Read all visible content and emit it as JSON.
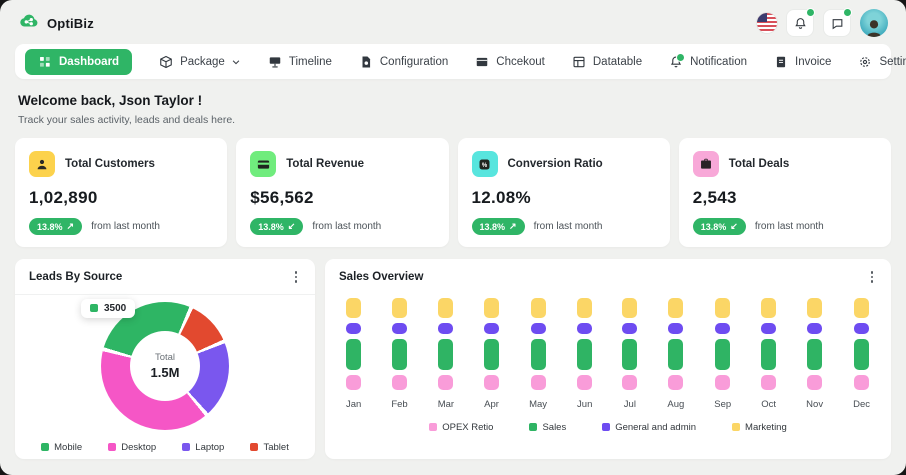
{
  "brand": {
    "name": "OptiBiz"
  },
  "header": {
    "icons": [
      {
        "name": "us-flag-icon"
      },
      {
        "name": "bell-icon",
        "badge": true
      },
      {
        "name": "chat-icon",
        "badge": true
      },
      {
        "name": "user-avatar"
      }
    ]
  },
  "nav": {
    "items": [
      {
        "id": "dashboard",
        "label": "Dashboard",
        "icon": "grid-icon",
        "active": true
      },
      {
        "id": "package",
        "label": "Package",
        "icon": "package-icon",
        "chevron": true
      },
      {
        "id": "timeline",
        "label": "Timeline",
        "icon": "timeline-icon"
      },
      {
        "id": "configuration",
        "label": "Configuration",
        "icon": "configuration-icon"
      },
      {
        "id": "chcekout",
        "label": "Chcekout",
        "icon": "checkout-icon"
      },
      {
        "id": "datatable",
        "label": "Datatable",
        "icon": "datatable-icon"
      },
      {
        "id": "notification",
        "label": "Notification",
        "icon": "notification-icon",
        "dot": true
      },
      {
        "id": "invoice",
        "label": "Invoice",
        "icon": "invoice-icon"
      },
      {
        "id": "settings",
        "label": "Settings",
        "icon": "settings-icon"
      }
    ]
  },
  "welcome": {
    "title": "Welcome back, Json Taylor !",
    "subtitle": "Track your sales activity, leads and deals here."
  },
  "stats": [
    {
      "label": "Total Customers",
      "value": "1,02,890",
      "change": "13.8%",
      "direction": "up",
      "note": "from last month",
      "tile_color": "#fcd24c",
      "icon": "user-icon"
    },
    {
      "label": "Total Revenue",
      "value": "$56,562",
      "change": "13.8%",
      "direction": "down",
      "note": "from last month",
      "tile_color": "#70ec7d",
      "icon": "credit-card-icon"
    },
    {
      "label": "Conversion Ratio",
      "value": "12.08%",
      "change": "13.8%",
      "direction": "up",
      "note": "from last month",
      "tile_color": "#58e5de",
      "icon": "percent-icon"
    },
    {
      "label": "Total Deals",
      "value": "2,543",
      "change": "13.8%",
      "direction": "down",
      "note": "from last month",
      "tile_color": "#f8a8d8",
      "icon": "briefcase-icon"
    }
  ],
  "pill_color": "#2fb566",
  "chart_data": [
    {
      "type": "pie",
      "title": "Leads By Source",
      "center_label": "Total",
      "center_value": "1.5M",
      "tooltip": {
        "label": "3500",
        "color": "#2eb564"
      },
      "start_angle_deg": 287,
      "segments": [
        {
          "name": "Mobile",
          "percent": 27.5,
          "color": "#2eb564"
        },
        {
          "name": "Tablet",
          "percent": 12,
          "color": "#e2492f"
        },
        {
          "name": "Laptop",
          "percent": 20,
          "color": "#7a57ee"
        },
        {
          "name": "Desktop",
          "percent": 40.5,
          "color": "#f556c6"
        }
      ],
      "legend": [
        {
          "label": "Mobile",
          "color": "#2eb564"
        },
        {
          "label": "Desktop",
          "color": "#f556c6"
        },
        {
          "label": "Laptop",
          "color": "#7a57ee"
        },
        {
          "label": "Tablet",
          "color": "#e2492f"
        }
      ]
    },
    {
      "type": "bar",
      "title": "Sales Overview",
      "categories": [
        "Jan",
        "Feb",
        "Mar",
        "Apr",
        "May",
        "Jun",
        "Jul",
        "Aug",
        "Sep",
        "Oct",
        "Nov",
        "Dec"
      ],
      "series": [
        {
          "name": "Marketing",
          "color": "#fbd666",
          "values": [
            20,
            20,
            20,
            20,
            20,
            20,
            20,
            20,
            20,
            20,
            20,
            20
          ]
        },
        {
          "name": "General and admin",
          "color": "#6e4cf1",
          "values": [
            11,
            11,
            11,
            11,
            11,
            11,
            11,
            11,
            11,
            11,
            11,
            11
          ]
        },
        {
          "name": "Sales",
          "color": "#2fb464",
          "values": [
            31,
            31,
            31,
            31,
            31,
            31,
            31,
            31,
            31,
            31,
            31,
            31
          ]
        },
        {
          "name": "OPEX Retio",
          "color": "#f99cd9",
          "values": [
            15,
            15,
            15,
            15,
            15,
            15,
            15,
            15,
            15,
            15,
            15,
            15
          ]
        }
      ],
      "legend": [
        {
          "label": "OPEX Retio",
          "color": "#f99cd9"
        },
        {
          "label": "Sales",
          "color": "#2fb464"
        },
        {
          "label": "General and admin",
          "color": "#6e4cf1"
        },
        {
          "label": "Marketing",
          "color": "#fbd666"
        }
      ]
    }
  ]
}
